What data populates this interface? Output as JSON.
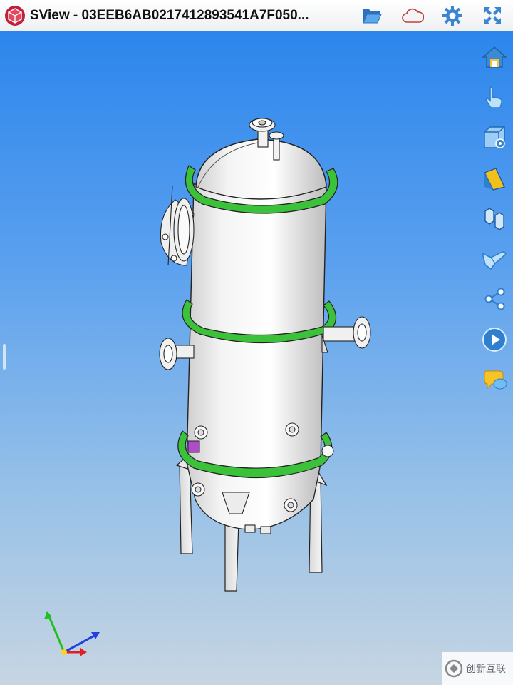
{
  "app": {
    "title": "SView - 03EEB6AB0217412893541A7F050...",
    "brand_color": "#c0203a"
  },
  "titlebar": {
    "buttons": [
      {
        "name": "open-folder",
        "icon": "folder-open-icon"
      },
      {
        "name": "cloud",
        "icon": "cloud-icon"
      },
      {
        "name": "settings",
        "icon": "gear-icon"
      },
      {
        "name": "fullscreen",
        "icon": "fullscreen-icon"
      }
    ]
  },
  "side_toolbar": {
    "buttons": [
      {
        "name": "home-view",
        "icon": "home-icon"
      },
      {
        "name": "gesture",
        "icon": "hand-pointer-icon"
      },
      {
        "name": "view-cube",
        "icon": "cube-settings-icon"
      },
      {
        "name": "section",
        "icon": "section-plane-icon"
      },
      {
        "name": "explode",
        "icon": "explode-icon"
      },
      {
        "name": "measure",
        "icon": "hand-measure-icon"
      },
      {
        "name": "share",
        "icon": "share-icon"
      },
      {
        "name": "play-animation",
        "icon": "play-icon"
      },
      {
        "name": "annotation",
        "icon": "comment-bubble-icon"
      }
    ]
  },
  "viewport": {
    "background_top": "#2c86ec",
    "background_bottom": "#c7d5e2",
    "flange_ring_color": "#3cc23a",
    "axis_colors": {
      "x": "#e02020",
      "y": "#20c020",
      "z": "#2040e0"
    }
  },
  "watermark": {
    "text": "创新互联"
  }
}
